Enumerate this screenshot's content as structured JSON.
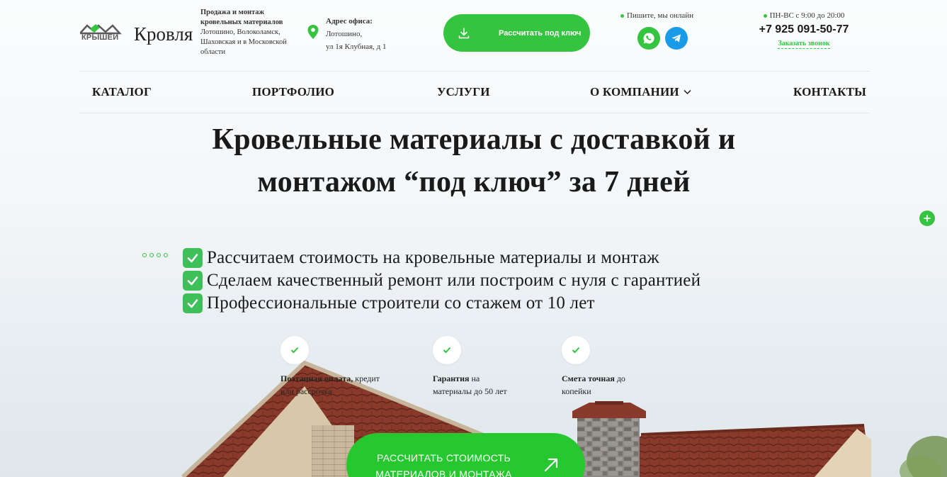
{
  "brand": {
    "logo_mark_text": "КРЫШЕЙ",
    "logo_word": "Кровля",
    "tagline_title": "Продажа и монтаж кровельных материалов",
    "tagline_text": "Лотошино, Волоколамск, Шаховская и в Московской области"
  },
  "address": {
    "title": "Адрес офиса:",
    "line1": "Лотошино,",
    "line2": "ул 1я Клубная, д 1"
  },
  "header_button": {
    "label": "Рассчитать под ключ",
    "icon": "download-icon"
  },
  "messengers": {
    "online_text": "Пишите, мы онлайн",
    "items": [
      "whatsapp-icon",
      "telegram-icon"
    ]
  },
  "contact": {
    "hours": "ПН-ВС с 9:00 до 20:00",
    "phone": "+7 925 091-50-77",
    "callback": "Заказать звонок"
  },
  "nav": {
    "items": [
      "КАТАЛОГ",
      "ПОРТФОЛИО",
      "УСЛУГИ",
      "О КОМПАНИИ",
      "КОНТАКТЫ"
    ]
  },
  "hero": {
    "title_line1": "Кровельные материалы с доставкой и",
    "title_line2": "монтажом “под ключ” за 7 дней",
    "benefits": [
      "Рассчитаем стоимость на кровельные материалы и монтаж",
      "Сделаем качественный ремонт или построим с нуля с гарантией",
      "Профессиональные строители со стажем от 10 лет"
    ]
  },
  "features": [
    {
      "bold": "Поэтапная оплата,",
      "text1": " кредит",
      "text2": "или рассрочка"
    },
    {
      "bold": "Гарантия",
      "text1": " на",
      "text2": "материалы до 50 лет"
    },
    {
      "bold": "Смета точная",
      "text1": " до",
      "text2": "копейки"
    }
  ],
  "cta": {
    "line1": "РАССЧИТАТЬ СТОИМОСТЬ",
    "line2": "МАТЕРИАЛОВ И МОНТАЖА"
  },
  "colors": {
    "accent": "#35c43f",
    "telegram": "#1a9be8",
    "roof": "#7e3325"
  }
}
